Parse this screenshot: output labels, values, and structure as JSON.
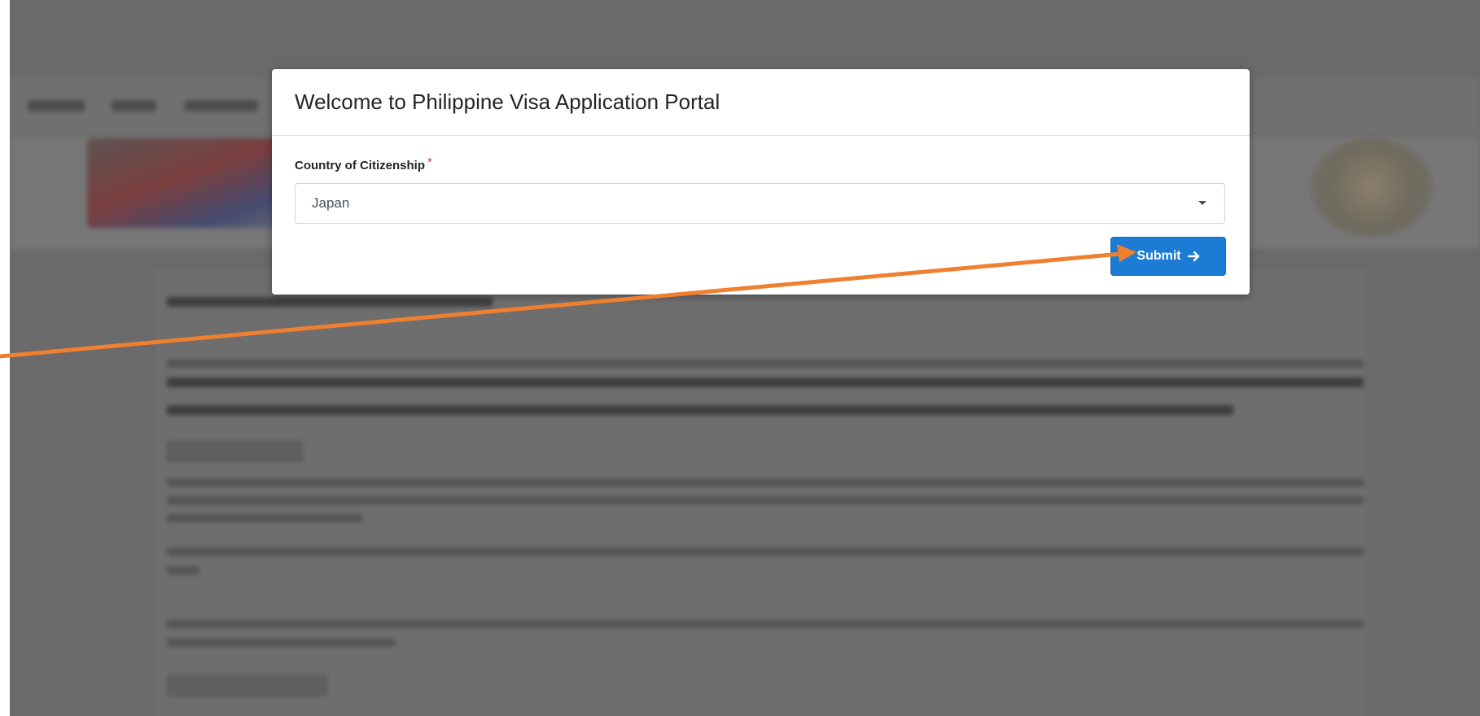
{
  "modal": {
    "title": "Welcome to Philippine Visa Application Portal",
    "field_label": "Country of Citizenship",
    "required_marker": "*",
    "selected_country": "Japan",
    "submit_label": "Submit"
  },
  "icons": {
    "dropdown": "chevron-down-icon",
    "submit": "arrow-right-icon"
  },
  "colors": {
    "primary_button": "#1c7cd5",
    "required": "#dc3545",
    "overlay": "#6a6a6a",
    "annotation": "#f07f2e"
  }
}
